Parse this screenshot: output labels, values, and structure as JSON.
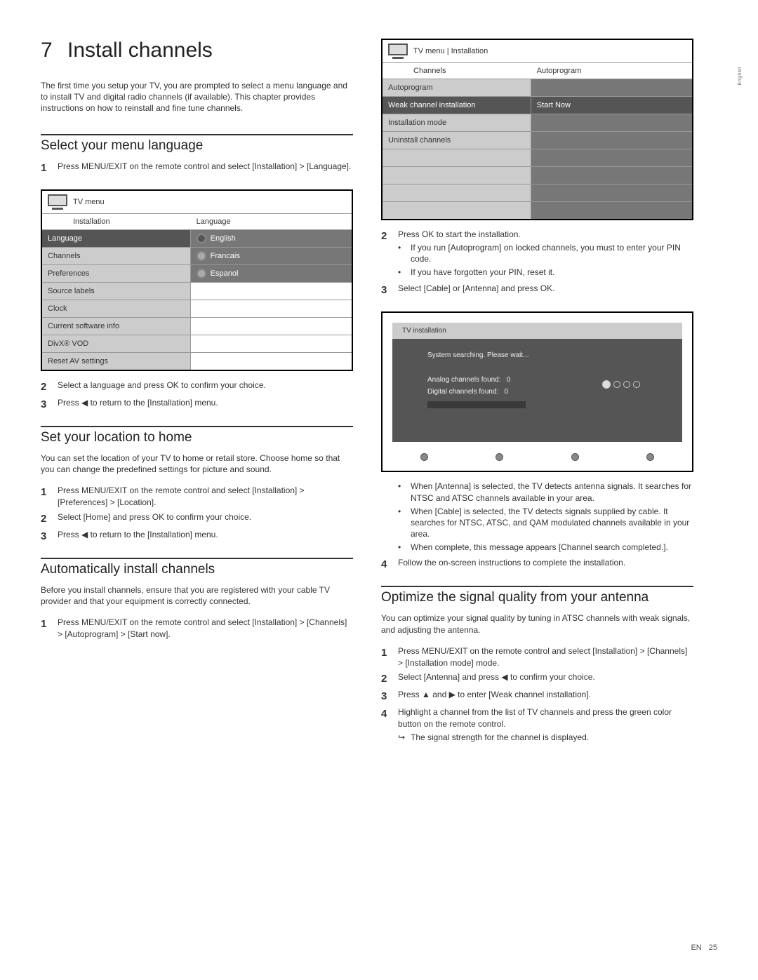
{
  "chapter": {
    "number": "7",
    "title": "Install channels"
  },
  "intro": "The first time you setup your TV, you are prompted to select a menu language and to install TV and digital radio channels (if available). This chapter provides instructions on how to reinstall and fine tune channels.",
  "sec1": {
    "title": "Select your menu language",
    "step1": "Press MENU/EXIT on the remote control and select [Installation] > [Language].",
    "step2": "Select a language and press OK to confirm your choice.",
    "step3": "Press ◀ to return to the [Installation] menu."
  },
  "sec2": {
    "title": "Set your location to home",
    "para": "You can set the location of your TV to home or retail store. Choose home so that you can change the predefined settings for picture and sound.",
    "step1": "Press MENU/EXIT on the remote control and select [Installation] > [Preferences] > [Location].",
    "step2": "Select [Home] and press OK to confirm your choice.",
    "step3": "Press ◀ to return to the [Installation] menu."
  },
  "sec3": {
    "title": "Automatically install channels",
    "para": "Before you install channels, ensure that you are registered with your cable TV provider and that your equipment is correctly connected.",
    "step1": "Press MENU/EXIT on the remote control and select [Installation] > [Channels] > [Autoprogram] > [Start now].",
    "step2": "Press OK to start the installation.",
    "step2a": "If you run [Autoprogram] on locked channels, you must to enter your PIN code.",
    "step2b": "If you have forgotten your PIN, reset it.",
    "step3": "Select [Cable] or [Antenna] and press OK.",
    "step3a": "When [Antenna] is selected, the TV detects antenna signals. It searches for NTSC and ATSC channels available in your area.",
    "step3b": "When [Cable] is selected, the TV detects signals supplied by cable. It searches for NTSC, ATSC, and QAM modulated channels available in your area.",
    "step3c": "When complete, this message appears [Channel search completed.].",
    "step4": "Follow the on-screen instructions to complete the installation."
  },
  "sec4": {
    "title": "Optimize the signal quality from your antenna",
    "para": "You can optimize your signal quality by tuning in ATSC channels with weak signals, and adjusting the antenna.",
    "step1": "Press MENU/EXIT on the remote control and select [Installation] > [Channels] > [Installation mode] mode.",
    "step2": "Select [Antenna] and press ◀ to confirm your choice.",
    "step3": "Press ▲ and ▶ to enter [Weak channel installation].",
    "step4": "Highlight a channel from the list of TV channels and press the green color button on the remote control.",
    "step4a": "The signal strength for the channel is displayed."
  },
  "menu1": {
    "top": "TV menu",
    "l0": "Installation",
    "r0": "Language",
    "left": [
      "Language",
      "Channels",
      "Preferences",
      "Source labels",
      "Clock",
      "Current software info",
      "DivX® VOD",
      "Reset AV settings"
    ],
    "right": [
      "English",
      "Francais",
      "Espanol"
    ]
  },
  "menu2": {
    "top_l": "TV menu",
    "top_r": "Installation",
    "l0": "Channels",
    "r0": "Autoprogram",
    "left": [
      "Autoprogram",
      "Weak channel installation",
      "Installation mode",
      "Uninstall channels"
    ],
    "right": [
      "",
      "Start Now",
      "",
      ""
    ]
  },
  "installer": {
    "title": "TV installation",
    "msg": "System searching. Please wait...",
    "analog_label": "Analog channels found:",
    "analog_val": "0",
    "digital_label": "Digital channels found:",
    "digital_val": "0"
  },
  "sidetag": "English",
  "footer": {
    "lang": "EN",
    "page": "25"
  }
}
